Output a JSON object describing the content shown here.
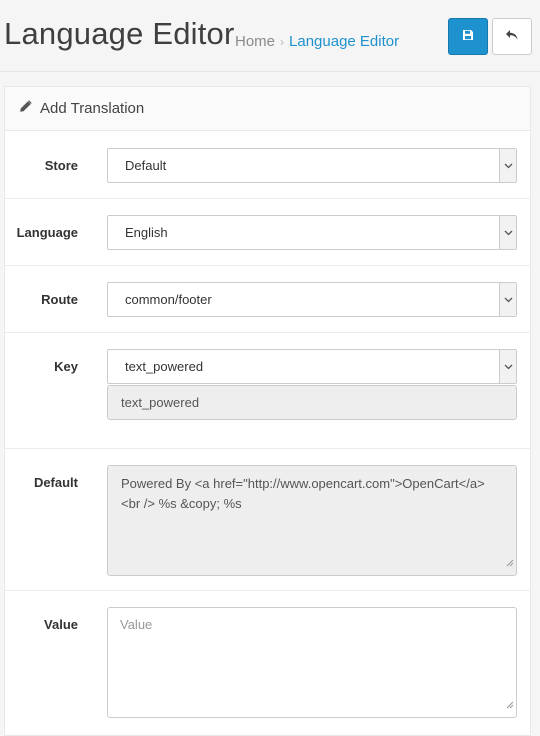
{
  "header": {
    "title": "Language Editor",
    "breadcrumb": [
      {
        "label": "Home"
      },
      {
        "label": "Language Editor"
      }
    ],
    "breadcrumb_separator": "›",
    "save_icon": "floppy-disk-icon",
    "back_icon": "reply-arrow-icon"
  },
  "panel": {
    "icon": "pencil-icon",
    "title": "Add Translation"
  },
  "form": {
    "store": {
      "label": "Store",
      "value": "Default"
    },
    "language": {
      "label": "Language",
      "value": "English"
    },
    "route": {
      "label": "Route",
      "value": "common/footer"
    },
    "key": {
      "label": "Key",
      "value": "text_powered",
      "readonly_value": "text_powered"
    },
    "default": {
      "label": "Default",
      "value": "Powered By <a href=\"http://www.opencart.com\">OpenCart</a><br /> %s &copy; %s"
    },
    "value": {
      "label": "Value",
      "placeholder": "Value"
    }
  },
  "colors": {
    "accent": "#1e91cf",
    "background": "#f5f5f5"
  }
}
